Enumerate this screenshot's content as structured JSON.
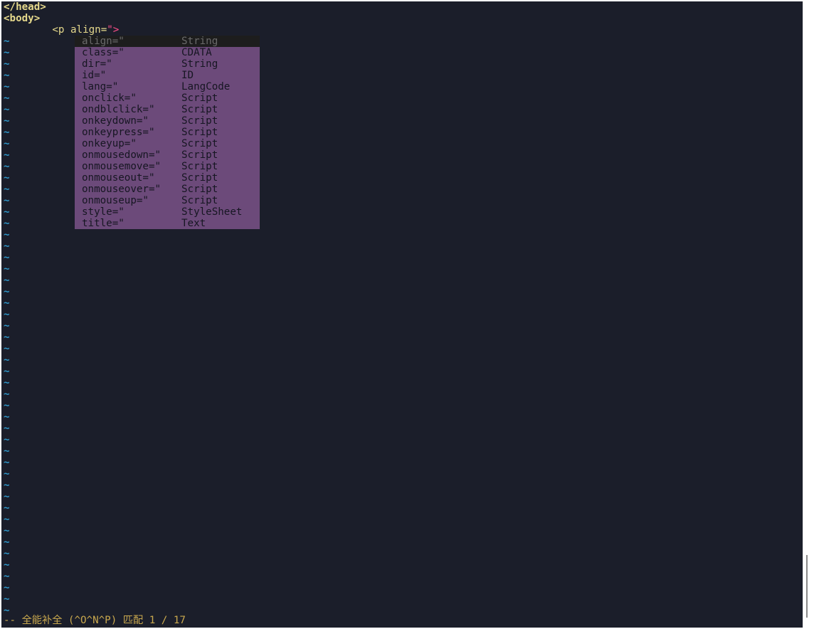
{
  "editor": {
    "lines": [
      {
        "text": "</head>",
        "role": "tag"
      },
      {
        "text": "<body>",
        "role": "tag"
      }
    ],
    "current_line": {
      "indent": "        ",
      "tag_open": "<p",
      "attr": "align=",
      "quote": "\"",
      "tag_close": ">"
    },
    "tilde": "~",
    "tilde_count": 51
  },
  "completion_menu": {
    "selected_index": 0,
    "items": [
      {
        "name": "align=\"",
        "type": "String"
      },
      {
        "name": "class=\"",
        "type": "CDATA"
      },
      {
        "name": "dir=\"",
        "type": "String"
      },
      {
        "name": "id=\"",
        "type": "ID"
      },
      {
        "name": "lang=\"",
        "type": "LangCode"
      },
      {
        "name": "onclick=\"",
        "type": "Script"
      },
      {
        "name": "ondblclick=\"",
        "type": "Script"
      },
      {
        "name": "onkeydown=\"",
        "type": "Script"
      },
      {
        "name": "onkeypress=\"",
        "type": "Script"
      },
      {
        "name": "onkeyup=\"",
        "type": "Script"
      },
      {
        "name": "onmousedown=\"",
        "type": "Script"
      },
      {
        "name": "onmousemove=\"",
        "type": "Script"
      },
      {
        "name": "onmouseout=\"",
        "type": "Script"
      },
      {
        "name": "onmouseover=\"",
        "type": "Script"
      },
      {
        "name": "onmouseup=\"",
        "type": "Script"
      },
      {
        "name": "style=\"",
        "type": "StyleSheet"
      },
      {
        "name": "title=\"",
        "type": "Text"
      }
    ]
  },
  "statusline": {
    "mode": "-- 全能补全 (^O^N^P)",
    "match": "匹配 1 / 17"
  },
  "colors": {
    "background": "#1b1e2a",
    "tag": "#e6d98c",
    "string": "#ff4f8b",
    "tilde": "#2f97c8",
    "popup": "#6c4a7a",
    "popup_selected": "#1d1d1d"
  }
}
